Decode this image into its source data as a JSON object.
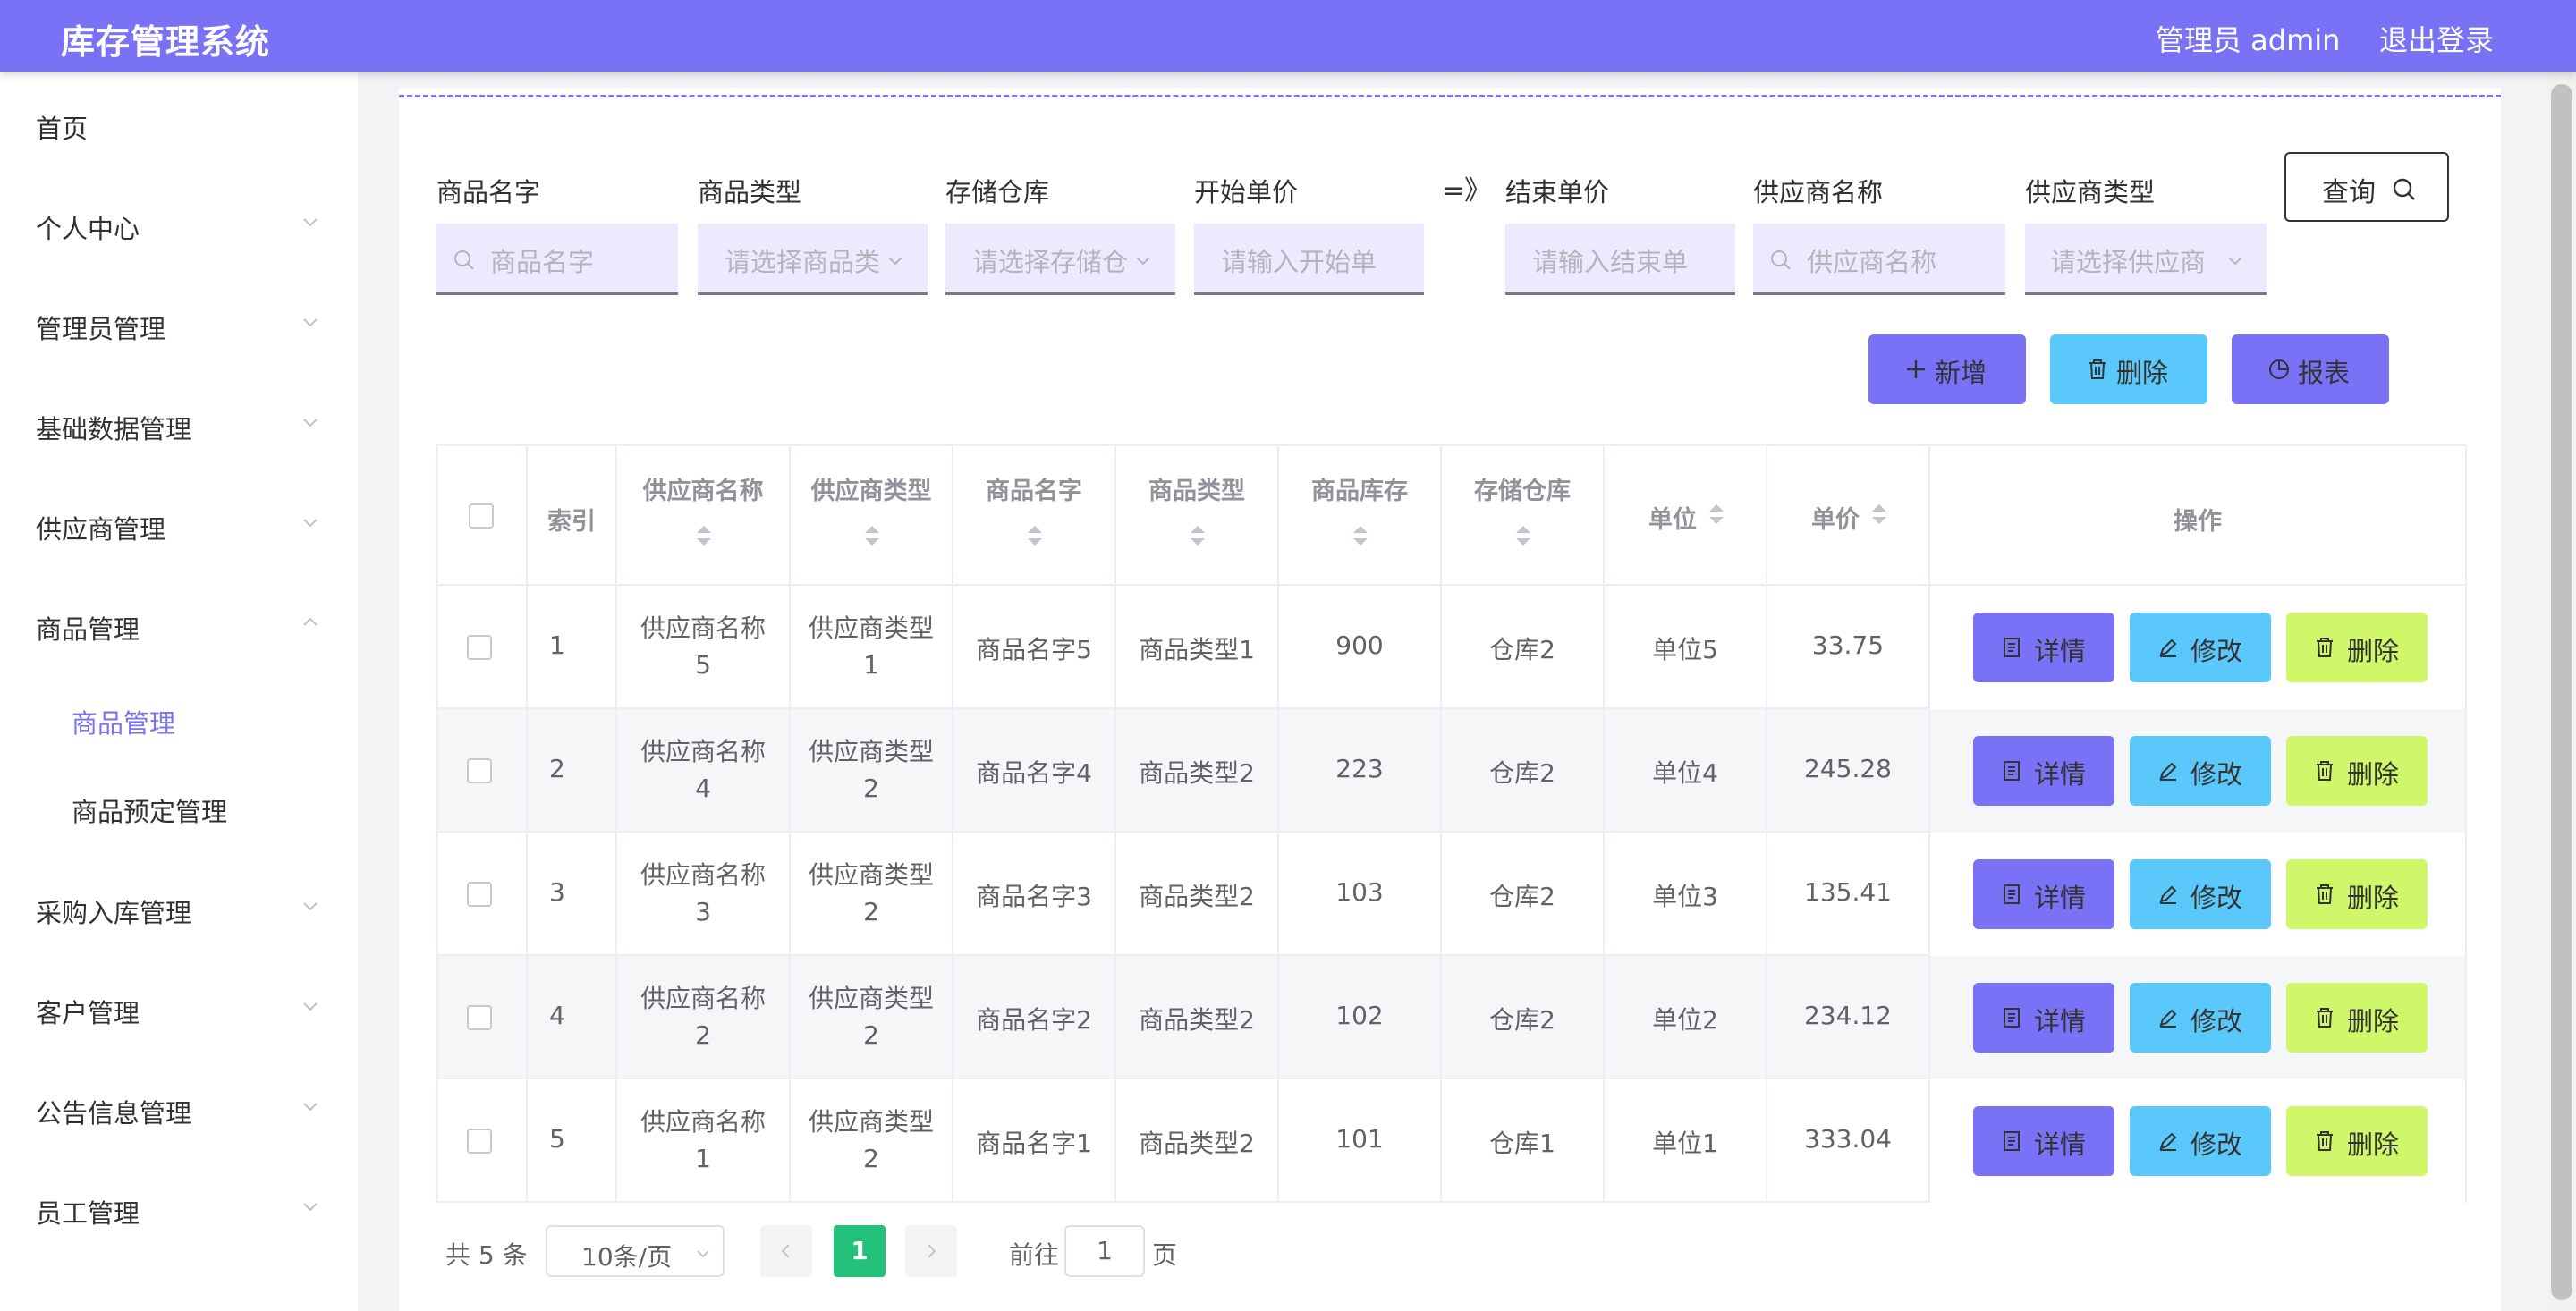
{
  "app": {
    "title": "库存管理系统",
    "user": "管理员 admin",
    "logout": "退出登录"
  },
  "sidebar": {
    "items": [
      {
        "label": "首页"
      },
      {
        "label": "个人中心"
      },
      {
        "label": "管理员管理"
      },
      {
        "label": "基础数据管理"
      },
      {
        "label": "供应商管理"
      },
      {
        "label": "商品管理"
      },
      {
        "label": "采购入库管理"
      },
      {
        "label": "客户管理"
      },
      {
        "label": "公告信息管理"
      },
      {
        "label": "员工管理"
      }
    ],
    "subitems": [
      {
        "label": "商品管理"
      },
      {
        "label": "商品预定管理"
      }
    ]
  },
  "search": {
    "fields": [
      {
        "label": "商品名字",
        "placeholder": "商品名字"
      },
      {
        "label": "商品类型",
        "placeholder": "请选择商品类"
      },
      {
        "label": "存储仓库",
        "placeholder": "请选择存储仓"
      },
      {
        "label": "开始单价",
        "placeholder": "请输入开始单"
      },
      {
        "label": "结束单价",
        "placeholder": "请输入结束单"
      },
      {
        "label": "供应商名称",
        "placeholder": "供应商名称"
      },
      {
        "label": "供应商类型",
        "placeholder": "请选择供应商"
      }
    ],
    "range_sep": "=》",
    "query_label": "查询"
  },
  "actions": {
    "add": "新增",
    "delete": "删除",
    "report": "报表"
  },
  "table": {
    "headers": {
      "index": "索引",
      "supplier_name": "供应商名称",
      "supplier_type": "供应商类型",
      "goods_name": "商品名字",
      "goods_type": "商品类型",
      "stock": "商品库存",
      "warehouse": "存储仓库",
      "unit": "单位",
      "price": "单价",
      "ops": "操作"
    },
    "rows": [
      {
        "index": "1",
        "supplier_name": "供应商名称",
        "supplier_name_n": "5",
        "supplier_type": "供应商类型",
        "supplier_type_n": "1",
        "goods_name": "商品名字5",
        "goods_type": "商品类型1",
        "stock": "900",
        "warehouse": "仓库2",
        "unit": "单位5",
        "price": "33.75"
      },
      {
        "index": "2",
        "supplier_name": "供应商名称",
        "supplier_name_n": "4",
        "supplier_type": "供应商类型",
        "supplier_type_n": "2",
        "goods_name": "商品名字4",
        "goods_type": "商品类型2",
        "stock": "223",
        "warehouse": "仓库2",
        "unit": "单位4",
        "price": "245.28"
      },
      {
        "index": "3",
        "supplier_name": "供应商名称",
        "supplier_name_n": "3",
        "supplier_type": "供应商类型",
        "supplier_type_n": "2",
        "goods_name": "商品名字3",
        "goods_type": "商品类型2",
        "stock": "103",
        "warehouse": "仓库2",
        "unit": "单位3",
        "price": "135.41"
      },
      {
        "index": "4",
        "supplier_name": "供应商名称",
        "supplier_name_n": "2",
        "supplier_type": "供应商类型",
        "supplier_type_n": "2",
        "goods_name": "商品名字2",
        "goods_type": "商品类型2",
        "stock": "102",
        "warehouse": "仓库2",
        "unit": "单位2",
        "price": "234.12"
      },
      {
        "index": "5",
        "supplier_name": "供应商名称",
        "supplier_name_n": "1",
        "supplier_type": "供应商类型",
        "supplier_type_n": "2",
        "goods_name": "商品名字1",
        "goods_type": "商品类型2",
        "stock": "101",
        "warehouse": "仓库1",
        "unit": "单位1",
        "price": "333.04"
      }
    ],
    "row_actions": {
      "detail": "详情",
      "edit": "修改",
      "delete": "删除"
    }
  },
  "pagination": {
    "total": "共 5 条",
    "page_size": "10条/页",
    "current": "1",
    "goto_prefix": "前往",
    "goto_value": "1",
    "goto_suffix": "页"
  },
  "colors": {
    "topbar": "#7a72f6",
    "primary": "#7a72f6",
    "info": "#5ac8fa",
    "lime": "#d0f76a",
    "pagination_active": "#23c17a"
  }
}
